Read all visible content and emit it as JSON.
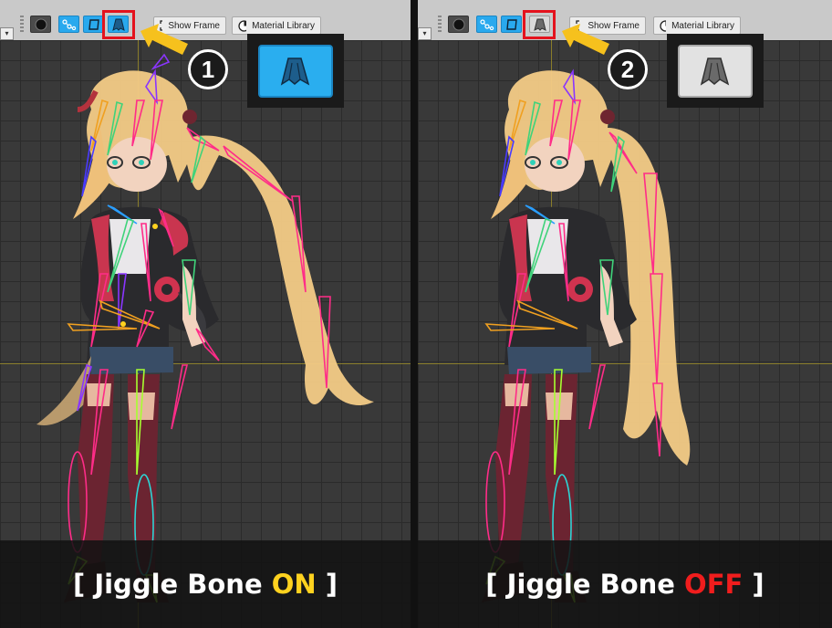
{
  "toolbar": {
    "show_frame_label": "Show Frame",
    "material_library_label": "Material Library",
    "dropdown_glyph": "▾"
  },
  "panels": [
    {
      "id": "left",
      "step_number": "1",
      "jiggle_button_state": "on",
      "caption": {
        "open": "[ ",
        "text": "Jiggle Bone ",
        "state": "ON",
        "close": " ]",
        "state_color": "#ffd21f"
      }
    },
    {
      "id": "right",
      "step_number": "2",
      "jiggle_button_state": "off",
      "caption": {
        "open": "[ ",
        "text": "Jiggle Bone ",
        "state": "OFF",
        "close": " ]",
        "state_color": "#f01d1d"
      }
    }
  ],
  "colors": {
    "highlight_red": "#e4121d",
    "arrow_yellow": "#f6c11d",
    "button_blue": "#29a9ee"
  },
  "icons": [
    "sphere-icon",
    "bone-chain-icon",
    "frame-icon",
    "skirt-icon",
    "show-frame-icon",
    "material-library-icon"
  ]
}
